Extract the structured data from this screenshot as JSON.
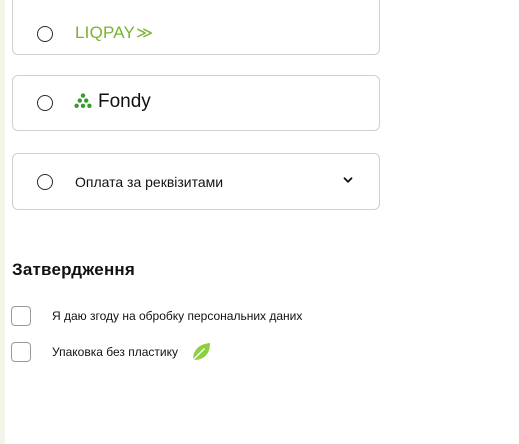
{
  "payment_options": [
    {
      "label": "LIQPAY",
      "arrow": "≫",
      "logo_color": "#7ab32e"
    },
    {
      "label": "Fondy",
      "logo_color": "#3a9a2d"
    },
    {
      "label": "Оплата за реквізитами"
    }
  ],
  "confirmation": {
    "title": "Затвердження",
    "items": [
      {
        "label": "Я даю згоду на обробку персональних даних"
      },
      {
        "label": "Упаковка без пластику",
        "icon": "leaf-icon",
        "icon_color": "#8ccf3f"
      }
    ]
  }
}
